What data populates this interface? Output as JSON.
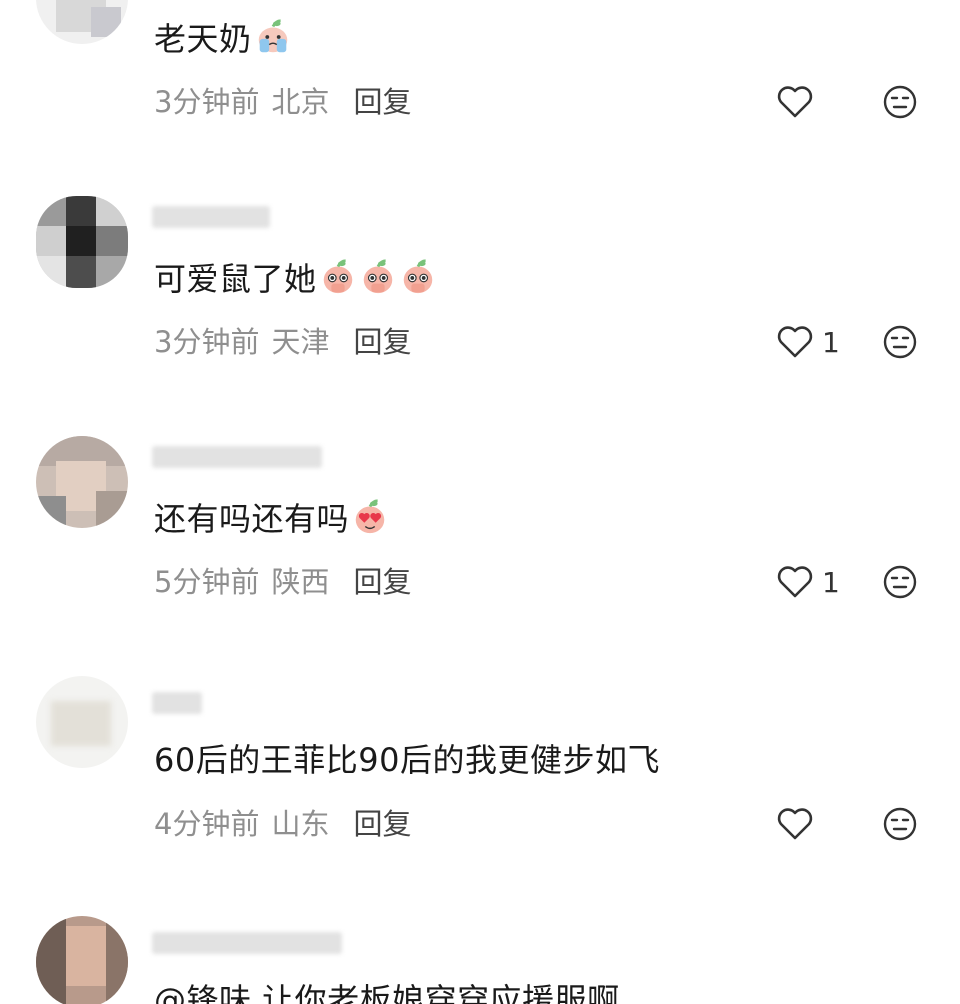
{
  "comments": [
    {
      "text": "老天奶",
      "emojis": [
        "crying-face"
      ],
      "time": "3分钟前",
      "location": "北京",
      "reply_label": "回复",
      "like_count": ""
    },
    {
      "text": "可爱鼠了她",
      "emojis": [
        "pleading-face",
        "pleading-face",
        "pleading-face"
      ],
      "time": "3分钟前",
      "location": "天津",
      "reply_label": "回复",
      "like_count": "1"
    },
    {
      "text": "还有吗还有吗",
      "emojis": [
        "heart-eyes-face"
      ],
      "time": "5分钟前",
      "location": "陕西",
      "reply_label": "回复",
      "like_count": "1"
    },
    {
      "text": "60后的王菲比90后的我更健步如飞",
      "emojis": [],
      "time": "4分钟前",
      "location": "山东",
      "reply_label": "回复",
      "like_count": ""
    },
    {
      "text": "@锋味 让你老板娘穿穿应援服啊",
      "emojis": [],
      "time": "",
      "location": "",
      "reply_label": "",
      "like_count": ""
    }
  ],
  "colors": {
    "meta_gray": "#8f8f8f",
    "reply": "#444444",
    "icon_stroke": "#333333",
    "emoji_peach": "#f6b5a8",
    "emoji_leaf": "#79c27a"
  }
}
